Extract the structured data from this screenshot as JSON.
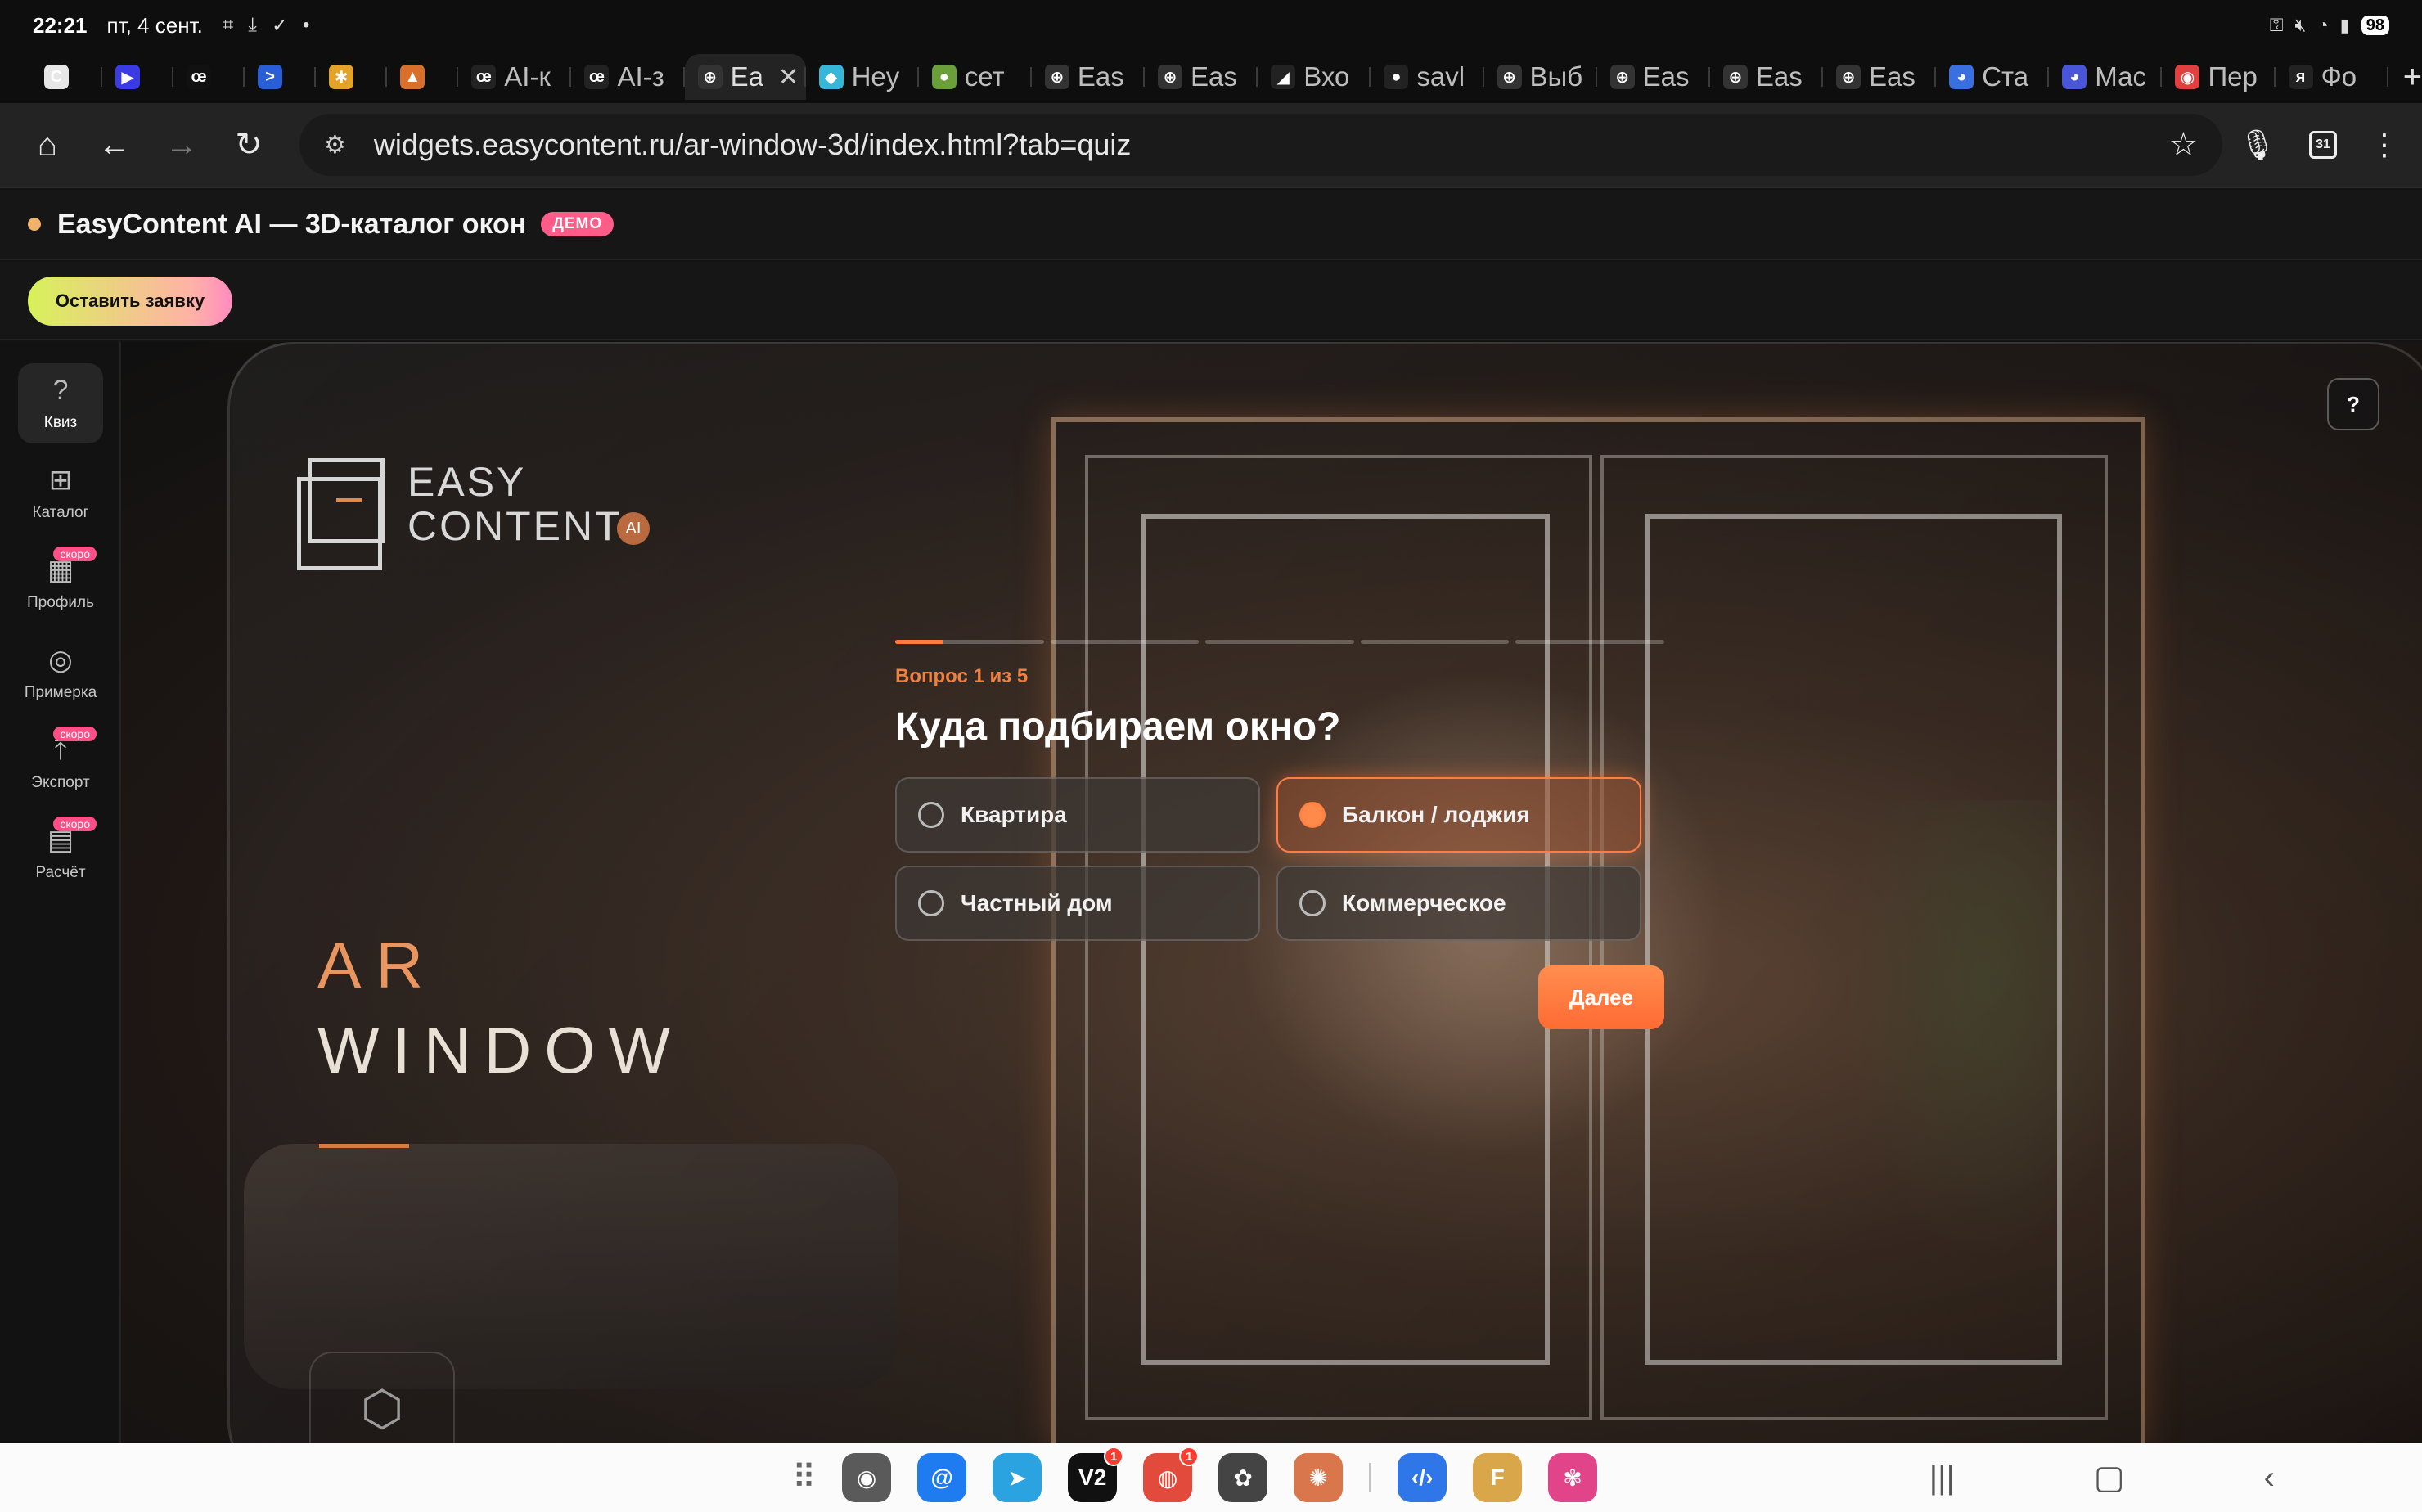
{
  "status_bar": {
    "time": "22:21",
    "date": "пт, 4 сент.",
    "battery": "98"
  },
  "browser_tabs": [
    {
      "label": "",
      "favicon": "C",
      "color": "#e6e6e6"
    },
    {
      "label": "",
      "favicon": "▶",
      "color": "#3b3be6"
    },
    {
      "label": "",
      "favicon": "œ",
      "color": "#111111"
    },
    {
      "label": "",
      "favicon": ">",
      "color": "#2a5ed6"
    },
    {
      "label": "",
      "favicon": "✱",
      "color": "#e3a22a"
    },
    {
      "label": "",
      "favicon": "▲",
      "color": "#d8702b"
    },
    {
      "label": "AI-к",
      "favicon": "œ",
      "color": "#222222"
    },
    {
      "label": "AI-з",
      "favicon": "œ",
      "color": "#222222"
    },
    {
      "label": "Ea",
      "favicon": "⊕",
      "color": "#333333",
      "active": true
    },
    {
      "label": "Hey",
      "favicon": "◆",
      "color": "#36b6d8"
    },
    {
      "label": "сет",
      "favicon": "●",
      "color": "#6a9f3a"
    },
    {
      "label": "Eas",
      "favicon": "⊕",
      "color": "#333333"
    },
    {
      "label": "Eas",
      "favicon": "⊕",
      "color": "#333333"
    },
    {
      "label": "Вхо",
      "favicon": "◢",
      "color": "#222222"
    },
    {
      "label": "savl",
      "favicon": "●",
      "color": "#222222"
    },
    {
      "label": "Выб",
      "favicon": "⊕",
      "color": "#333333"
    },
    {
      "label": "Eas",
      "favicon": "⊕",
      "color": "#333333"
    },
    {
      "label": "Eas",
      "favicon": "⊕",
      "color": "#333333"
    },
    {
      "label": "Eas",
      "favicon": "⊕",
      "color": "#333333"
    },
    {
      "label": "Ста",
      "favicon": "◕",
      "color": "#3a6fe0"
    },
    {
      "label": "Мас",
      "favicon": "◕",
      "color": "#4a56d8"
    },
    {
      "label": "Пер",
      "favicon": "◉",
      "color": "#e04040"
    },
    {
      "label": "Фо",
      "favicon": "я",
      "color": "#222222"
    }
  ],
  "toolbar": {
    "url": "widgets.easycontent.ru/ar-window-3d/index.html?tab=quiz",
    "calendar_day": "31"
  },
  "app": {
    "title": "EasyContent AI — 3D-каталог окон",
    "badge": "ДЕМО",
    "cta": "Оставить заявку",
    "accent": "#ff7a3d"
  },
  "sidebar": {
    "items": [
      {
        "label": "Квиз",
        "icon": "?",
        "active": true
      },
      {
        "label": "Каталог",
        "icon": "⊞"
      },
      {
        "label": "Профиль",
        "icon": "▦",
        "soon": "скоро"
      },
      {
        "label": "Примерка",
        "icon": "◎"
      },
      {
        "label": "Экспорт",
        "icon": "⤒",
        "soon": "скоро"
      },
      {
        "label": "Расчёт",
        "icon": "▤",
        "soon": "скоро"
      }
    ]
  },
  "hero": {
    "logo_line1": "EASY",
    "logo_line2": "CONTENT",
    "logo_ai": "AI",
    "ar_line1": "AR",
    "ar_line2": "WINDOW",
    "help": "?"
  },
  "quiz": {
    "progress_step": 1,
    "progress_total": 5,
    "question_counter": "Вопрос 1 из 5",
    "question": "Куда подбираем окно?",
    "options": [
      {
        "label": "Квартира",
        "selected": false
      },
      {
        "label": "Балкон / лоджия",
        "selected": true
      },
      {
        "label": "Частный дом",
        "selected": false
      },
      {
        "label": "Коммерческое",
        "selected": false
      }
    ],
    "next": "Далее"
  },
  "dock": {
    "apps": [
      {
        "name": "camera",
        "glyph": "◉",
        "color": "#5a5a5a"
      },
      {
        "name": "mail",
        "glyph": "@",
        "color": "#1f7cf0"
      },
      {
        "name": "telegram",
        "glyph": "➤",
        "color": "#2aa3e0"
      },
      {
        "name": "v2",
        "glyph": "V2",
        "color": "#111111",
        "badge": "1"
      },
      {
        "name": "chrome",
        "glyph": "◍",
        "color": "#e24b3b",
        "badge": "1"
      },
      {
        "name": "chatgpt",
        "glyph": "✿",
        "color": "#444444"
      },
      {
        "name": "claude",
        "glyph": "✺",
        "color": "#d9764c"
      },
      {
        "name": "code",
        "glyph": "‹/›",
        "color": "#2f77e8"
      },
      {
        "name": "files",
        "glyph": "F",
        "color": "#d9a64a"
      },
      {
        "name": "photos",
        "glyph": "✾",
        "color": "#e2448a"
      }
    ]
  }
}
